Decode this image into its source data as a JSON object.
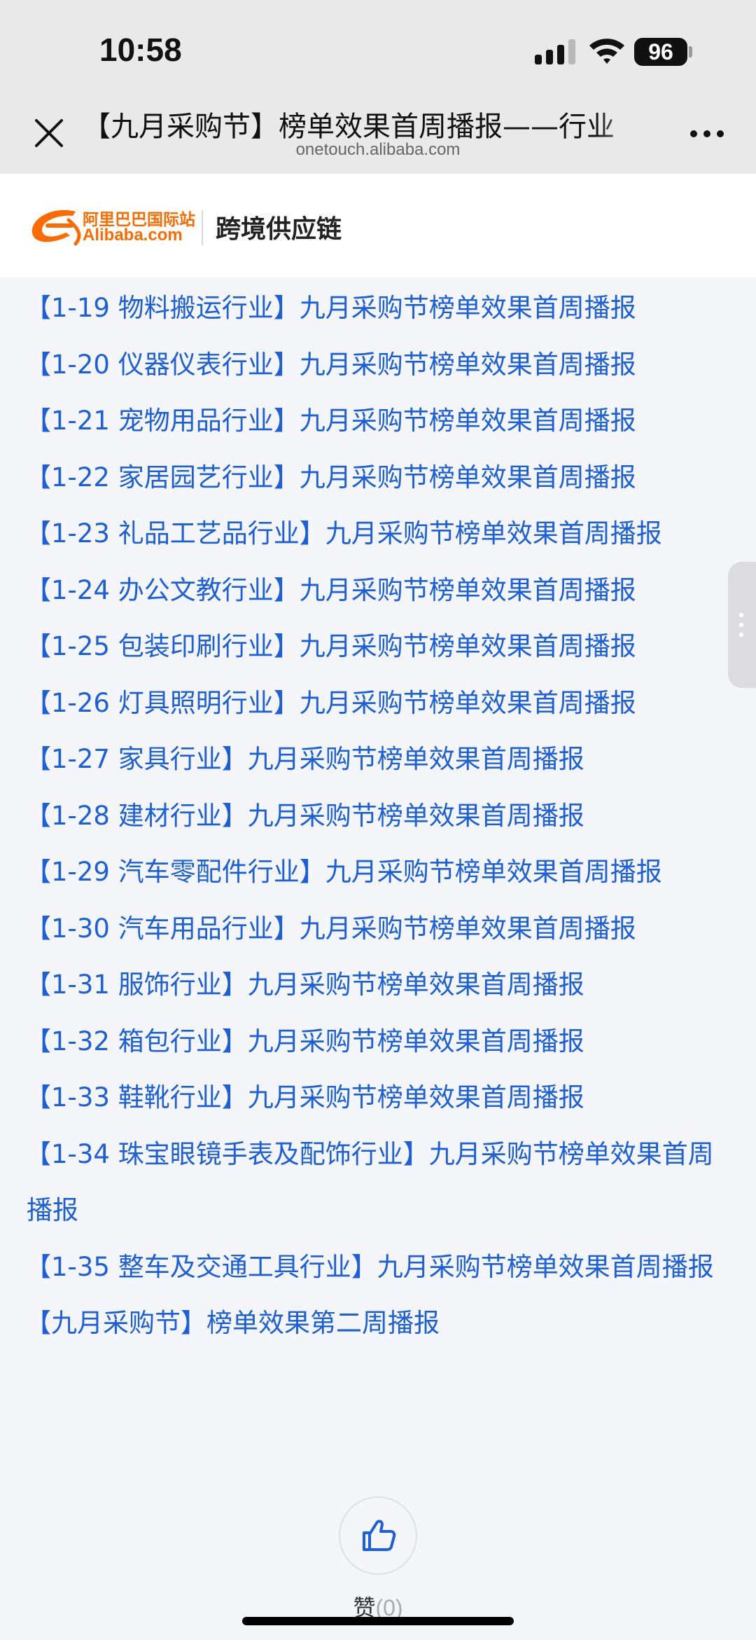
{
  "status_bar": {
    "time": "10:58",
    "battery": "96",
    "icons": [
      "signal-icon",
      "wifi-icon",
      "battery-icon"
    ]
  },
  "browser": {
    "title": "【九月采购节】榜单效果首周播报——行业",
    "domain": "onetouch.alibaba.com",
    "close_icon": "close-icon",
    "more_icon": "more-icon"
  },
  "brand": {
    "logo_cn": "阿里巴巴国际站",
    "logo_en": "Alibaba.com",
    "subtitle": "跨境供应链"
  },
  "links": [
    "【1-19 物料搬运行业】九月采购节榜单效果首周播报",
    "【1-20 仪器仪表行业】九月采购节榜单效果首周播报",
    "【1-21 宠物用品行业】九月采购节榜单效果首周播报",
    "【1-22 家居园艺行业】九月采购节榜单效果首周播报",
    "【1-23 礼品工艺品行业】九月采购节榜单效果首周播报",
    "【1-24 办公文教行业】九月采购节榜单效果首周播报",
    "【1-25 包装印刷行业】九月采购节榜单效果首周播报",
    "【1-26 灯具照明行业】九月采购节榜单效果首周播报",
    "【1-27 家具行业】九月采购节榜单效果首周播报",
    "【1-28 建材行业】九月采购节榜单效果首周播报",
    "【1-29 汽车零配件行业】九月采购节榜单效果首周播报",
    "【1-30 汽车用品行业】九月采购节榜单效果首周播报",
    "【1-31 服饰行业】九月采购节榜单效果首周播报",
    "【1-32 箱包行业】九月采购节榜单效果首周播报",
    "【1-33 鞋靴行业】九月采购节榜单效果首周播报",
    "【1-34 珠宝眼镜手表及配饰行业】九月采购节榜单效果首周播报",
    "【1-35 整车及交通工具行业】九月采购节榜单效果首周播报",
    "【九月采购节】榜单效果第二周播报"
  ],
  "like": {
    "label": "赞",
    "count": "(0)",
    "icon": "thumbs-up-icon"
  },
  "colors": {
    "link": "#1c5fdd",
    "brand_orange": "#ff6a00",
    "page_bg": "#f4f5f9",
    "bar_bg": "#e9e9ea"
  }
}
